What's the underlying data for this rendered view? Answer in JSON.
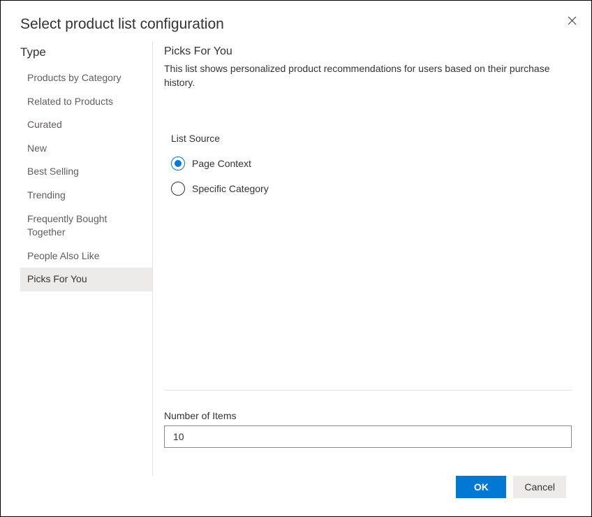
{
  "dialog": {
    "title": "Select product list configuration"
  },
  "sidebar": {
    "heading": "Type",
    "items": [
      {
        "label": "Products by Category"
      },
      {
        "label": "Related to Products"
      },
      {
        "label": "Curated"
      },
      {
        "label": "New"
      },
      {
        "label": "Best Selling"
      },
      {
        "label": "Trending"
      },
      {
        "label": "Frequently Bought Together"
      },
      {
        "label": "People Also Like"
      },
      {
        "label": "Picks For You"
      }
    ]
  },
  "main": {
    "heading": "Picks For You",
    "description": "This list shows personalized product recommendations for users based on their purchase history.",
    "list_source_label": "List Source",
    "radio_options": [
      {
        "label": "Page Context",
        "checked": true
      },
      {
        "label": "Specific Category",
        "checked": false
      }
    ],
    "number_label": "Number of Items",
    "number_value": "10"
  },
  "footer": {
    "ok_label": "OK",
    "cancel_label": "Cancel"
  }
}
